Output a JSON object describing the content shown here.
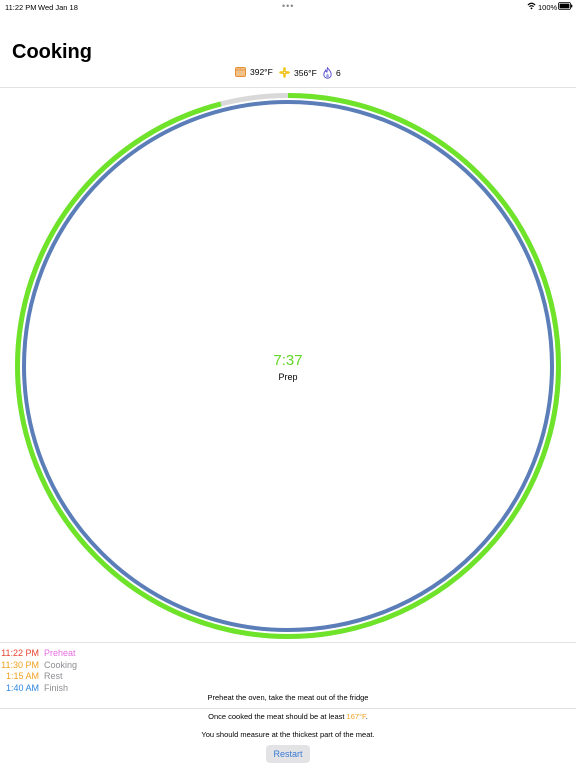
{
  "status_bar": {
    "time": "11:22 PM",
    "date": "Wed Jan 18",
    "battery": "100%"
  },
  "title": "Cooking",
  "stats": {
    "oven_temp": "392°F",
    "fan_temp": "356°F",
    "gas_level": "6",
    "oven_icon": "oven-icon",
    "fan_icon": "fan-icon",
    "gas_icon": "flame-icon"
  },
  "timer": {
    "remaining": "7:37",
    "phase": "Prep",
    "outer_progress": 0.96,
    "inner_progress": 1.0
  },
  "schedule": [
    {
      "time": "11:22 PM",
      "label": "Preheat",
      "time_color": "#e8432f",
      "label_color": "#e66ce0"
    },
    {
      "time": "11:30 PM",
      "label": "Cooking",
      "time_color": "#f0a020",
      "label_color": "#8e8e93"
    },
    {
      "time": "1:15 AM",
      "label": "Rest",
      "time_color": "#f0a020",
      "label_color": "#8e8e93"
    },
    {
      "time": "1:40 AM",
      "label": "Finish",
      "time_color": "#2e86de",
      "label_color": "#8e8e93"
    }
  ],
  "instructions": {
    "step": "Preheat the oven, take the meat out of the fridge",
    "target_prefix": "Once cooked the meat should be at least ",
    "target_temp": "167°F",
    "target_suffix": ".",
    "measure": "You should measure at the thickest part of the meat."
  },
  "restart_label": "Restart",
  "colors": {
    "outer_ring": "#6fe32a",
    "outer_track": "#d9d9d9",
    "inner_ring": "#5b7db8",
    "time_text": "#64d629",
    "accent_temp": "#f0a020",
    "button_text": "#3a7bd5"
  }
}
